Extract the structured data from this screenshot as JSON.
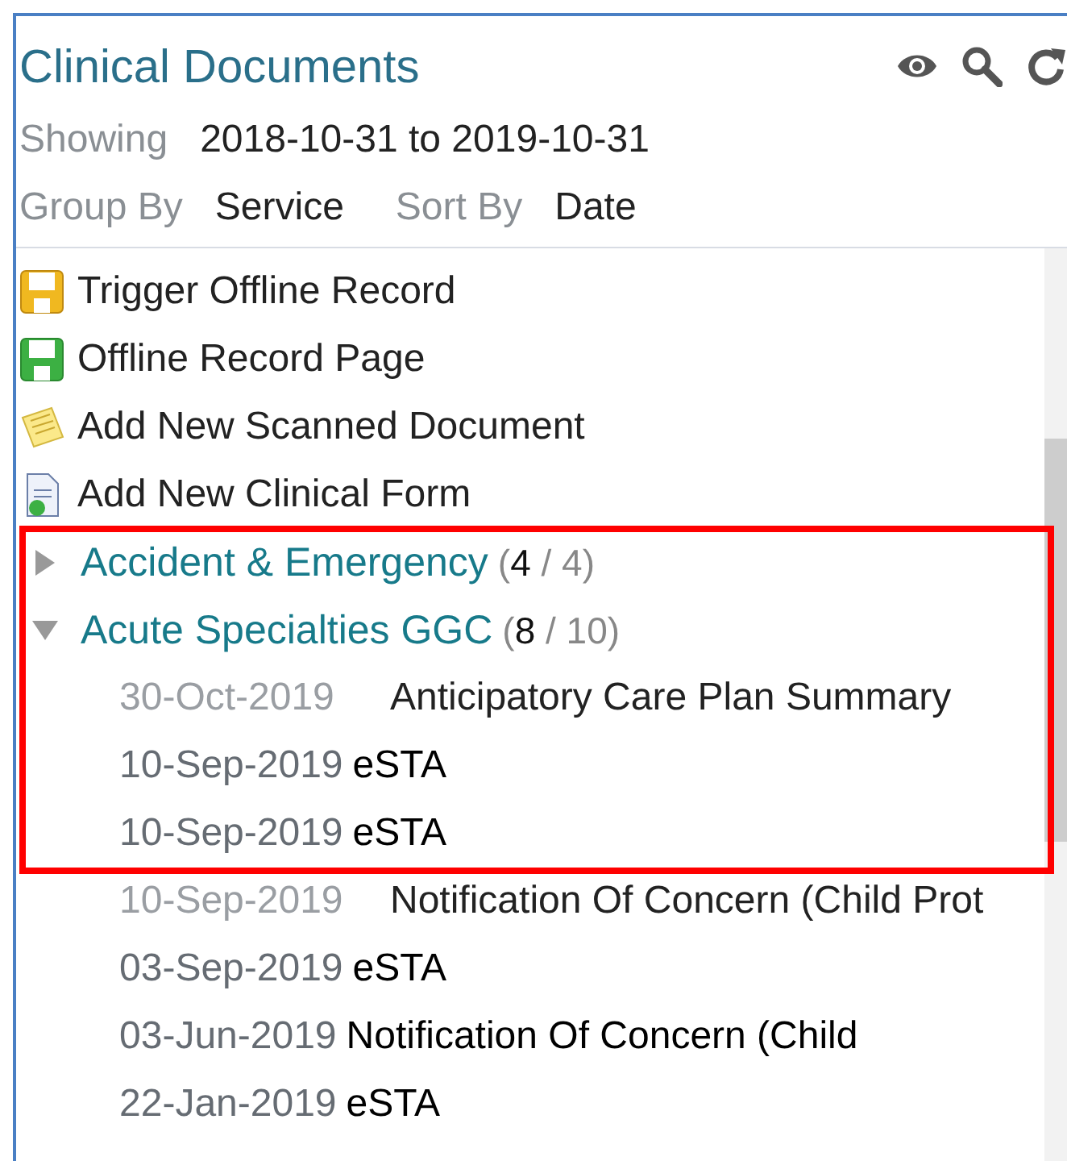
{
  "panel": {
    "title": "Clinical Documents",
    "filters": [
      {
        "label": "Showing",
        "value": "2018-10-31 to 2019-10-31"
      }
    ],
    "grouping": [
      {
        "label": "Group By",
        "value": "Service"
      },
      {
        "label": "Sort By",
        "value": "Date"
      }
    ]
  },
  "actions": [
    {
      "kind": "trigger",
      "label": "Trigger Offline Record"
    },
    {
      "kind": "offline",
      "label": "Offline Record Page"
    },
    {
      "kind": "scanned",
      "label": "Add New Scanned Document"
    },
    {
      "kind": "form",
      "label": "Add New Clinical Form"
    }
  ],
  "groups": [
    {
      "name": "Accident & Emergency",
      "count": "(**4** / 4)",
      "expanded": false
    },
    {
      "name": "Acute Specialties GGC",
      "count": "(**8** / 10)",
      "expanded": true,
      "documents": [
        {
          "date": "30-Oct-2019",
          "title": "Anticipatory Care Plan Summary",
          "unread": false
        },
        {
          "date": "10-Sep-2019",
          "title": "eSTA",
          "unread": true
        },
        {
          "date": "10-Sep-2019",
          "title": "eSTA",
          "unread": true
        },
        {
          "date": "10-Sep-2019",
          "title": "Notification Of Concern (Child Prot",
          "unread": false
        },
        {
          "date": "03-Sep-2019",
          "title": "eSTA",
          "unread": true
        },
        {
          "date": "03-Jun-2019",
          "title": "Notification Of Concern (Child",
          "unread": true
        },
        {
          "date": "22-Jan-2019",
          "title": "eSTA",
          "unread": true
        }
      ]
    }
  ]
}
